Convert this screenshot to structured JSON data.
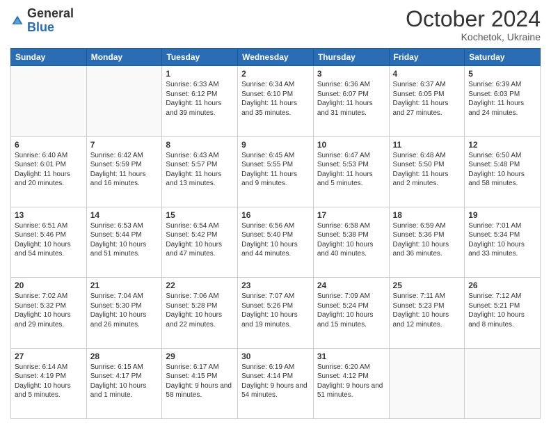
{
  "logo": {
    "text_general": "General",
    "text_blue": "Blue"
  },
  "header": {
    "month": "October 2024",
    "location": "Kochetok, Ukraine"
  },
  "weekdays": [
    "Sunday",
    "Monday",
    "Tuesday",
    "Wednesday",
    "Thursday",
    "Friday",
    "Saturday"
  ],
  "weeks": [
    [
      {
        "day": "",
        "content": ""
      },
      {
        "day": "",
        "content": ""
      },
      {
        "day": "1",
        "content": "Sunrise: 6:33 AM\nSunset: 6:12 PM\nDaylight: 11 hours and 39 minutes."
      },
      {
        "day": "2",
        "content": "Sunrise: 6:34 AM\nSunset: 6:10 PM\nDaylight: 11 hours and 35 minutes."
      },
      {
        "day": "3",
        "content": "Sunrise: 6:36 AM\nSunset: 6:07 PM\nDaylight: 11 hours and 31 minutes."
      },
      {
        "day": "4",
        "content": "Sunrise: 6:37 AM\nSunset: 6:05 PM\nDaylight: 11 hours and 27 minutes."
      },
      {
        "day": "5",
        "content": "Sunrise: 6:39 AM\nSunset: 6:03 PM\nDaylight: 11 hours and 24 minutes."
      }
    ],
    [
      {
        "day": "6",
        "content": "Sunrise: 6:40 AM\nSunset: 6:01 PM\nDaylight: 11 hours and 20 minutes."
      },
      {
        "day": "7",
        "content": "Sunrise: 6:42 AM\nSunset: 5:59 PM\nDaylight: 11 hours and 16 minutes."
      },
      {
        "day": "8",
        "content": "Sunrise: 6:43 AM\nSunset: 5:57 PM\nDaylight: 11 hours and 13 minutes."
      },
      {
        "day": "9",
        "content": "Sunrise: 6:45 AM\nSunset: 5:55 PM\nDaylight: 11 hours and 9 minutes."
      },
      {
        "day": "10",
        "content": "Sunrise: 6:47 AM\nSunset: 5:53 PM\nDaylight: 11 hours and 5 minutes."
      },
      {
        "day": "11",
        "content": "Sunrise: 6:48 AM\nSunset: 5:50 PM\nDaylight: 11 hours and 2 minutes."
      },
      {
        "day": "12",
        "content": "Sunrise: 6:50 AM\nSunset: 5:48 PM\nDaylight: 10 hours and 58 minutes."
      }
    ],
    [
      {
        "day": "13",
        "content": "Sunrise: 6:51 AM\nSunset: 5:46 PM\nDaylight: 10 hours and 54 minutes."
      },
      {
        "day": "14",
        "content": "Sunrise: 6:53 AM\nSunset: 5:44 PM\nDaylight: 10 hours and 51 minutes."
      },
      {
        "day": "15",
        "content": "Sunrise: 6:54 AM\nSunset: 5:42 PM\nDaylight: 10 hours and 47 minutes."
      },
      {
        "day": "16",
        "content": "Sunrise: 6:56 AM\nSunset: 5:40 PM\nDaylight: 10 hours and 44 minutes."
      },
      {
        "day": "17",
        "content": "Sunrise: 6:58 AM\nSunset: 5:38 PM\nDaylight: 10 hours and 40 minutes."
      },
      {
        "day": "18",
        "content": "Sunrise: 6:59 AM\nSunset: 5:36 PM\nDaylight: 10 hours and 36 minutes."
      },
      {
        "day": "19",
        "content": "Sunrise: 7:01 AM\nSunset: 5:34 PM\nDaylight: 10 hours and 33 minutes."
      }
    ],
    [
      {
        "day": "20",
        "content": "Sunrise: 7:02 AM\nSunset: 5:32 PM\nDaylight: 10 hours and 29 minutes."
      },
      {
        "day": "21",
        "content": "Sunrise: 7:04 AM\nSunset: 5:30 PM\nDaylight: 10 hours and 26 minutes."
      },
      {
        "day": "22",
        "content": "Sunrise: 7:06 AM\nSunset: 5:28 PM\nDaylight: 10 hours and 22 minutes."
      },
      {
        "day": "23",
        "content": "Sunrise: 7:07 AM\nSunset: 5:26 PM\nDaylight: 10 hours and 19 minutes."
      },
      {
        "day": "24",
        "content": "Sunrise: 7:09 AM\nSunset: 5:24 PM\nDaylight: 10 hours and 15 minutes."
      },
      {
        "day": "25",
        "content": "Sunrise: 7:11 AM\nSunset: 5:23 PM\nDaylight: 10 hours and 12 minutes."
      },
      {
        "day": "26",
        "content": "Sunrise: 7:12 AM\nSunset: 5:21 PM\nDaylight: 10 hours and 8 minutes."
      }
    ],
    [
      {
        "day": "27",
        "content": "Sunrise: 6:14 AM\nSunset: 4:19 PM\nDaylight: 10 hours and 5 minutes."
      },
      {
        "day": "28",
        "content": "Sunrise: 6:15 AM\nSunset: 4:17 PM\nDaylight: 10 hours and 1 minute."
      },
      {
        "day": "29",
        "content": "Sunrise: 6:17 AM\nSunset: 4:15 PM\nDaylight: 9 hours and 58 minutes."
      },
      {
        "day": "30",
        "content": "Sunrise: 6:19 AM\nSunset: 4:14 PM\nDaylight: 9 hours and 54 minutes."
      },
      {
        "day": "31",
        "content": "Sunrise: 6:20 AM\nSunset: 4:12 PM\nDaylight: 9 hours and 51 minutes."
      },
      {
        "day": "",
        "content": ""
      },
      {
        "day": "",
        "content": ""
      }
    ]
  ]
}
